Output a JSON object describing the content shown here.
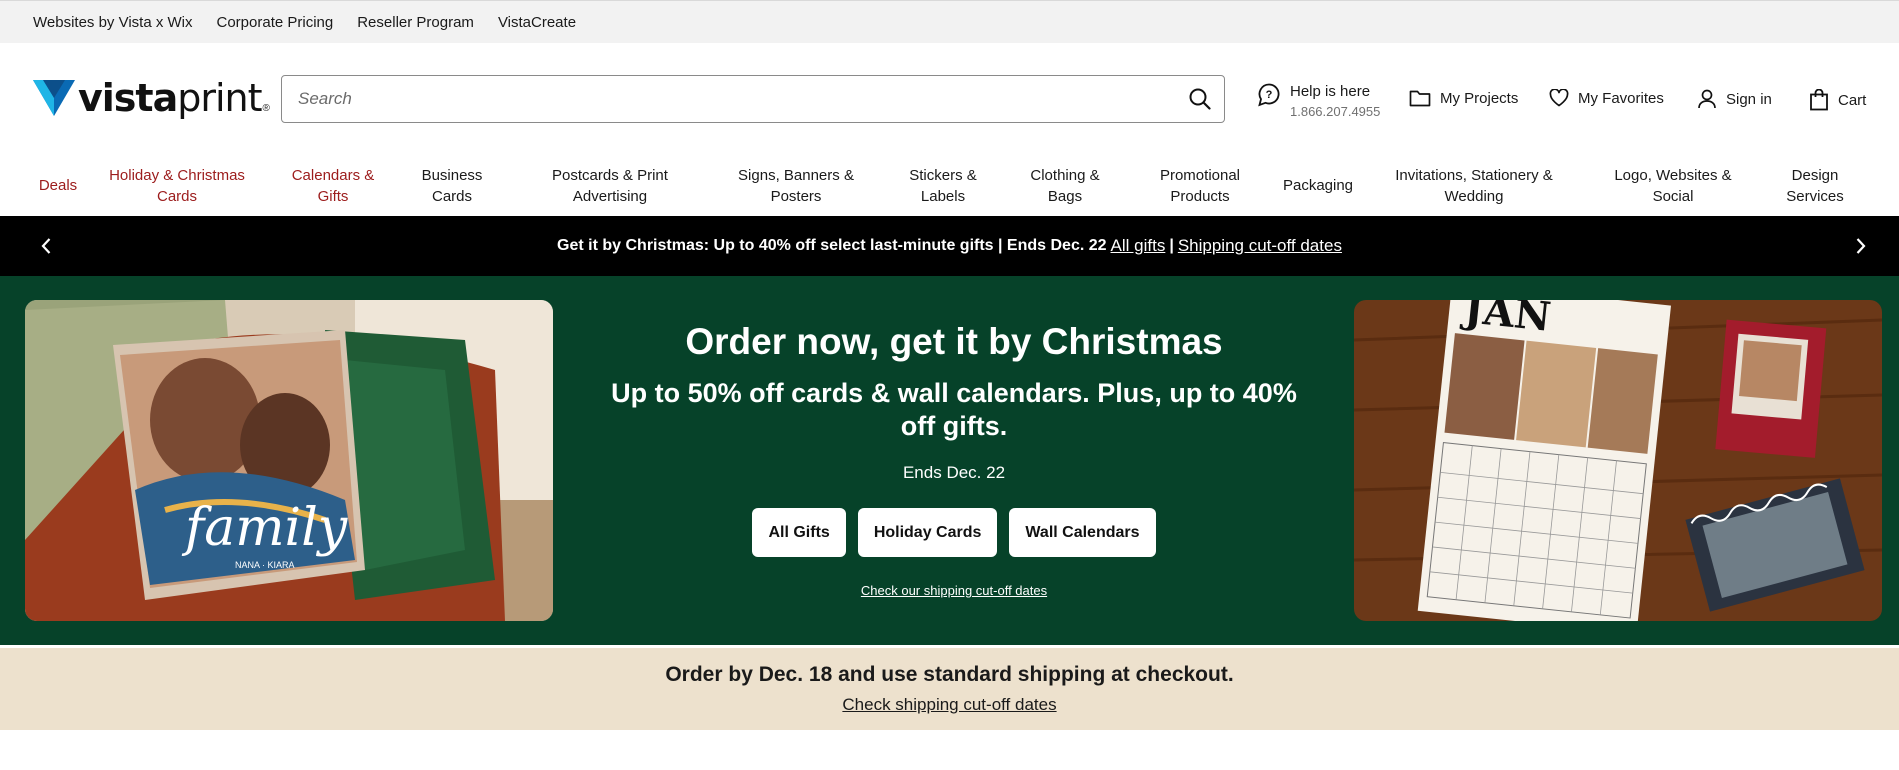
{
  "utility": {
    "links": [
      "Websites by Vista x Wix",
      "Corporate Pricing",
      "Reseller Program",
      "VistaCreate"
    ]
  },
  "brand": {
    "logo_primary": "vista",
    "logo_secondary": "print",
    "logo_mark": "®",
    "colors": {
      "logo_blue": "#0a6ab4",
      "logo_cyan": "#1fb5e6",
      "nav_red": "#9c1c1c",
      "hero_green": "#064229",
      "banner_beige": "#ede1cd"
    }
  },
  "search": {
    "placeholder": "Search",
    "icon": "search-icon"
  },
  "help": {
    "title": "Help is here",
    "phone": "1.866.207.4955",
    "icon": "help-bubble-icon"
  },
  "header_links": {
    "projects": "My Projects",
    "favorites": "My Favorites",
    "signin": "Sign in",
    "cart": "Cart"
  },
  "nav": {
    "items": [
      {
        "label": "Deals"
      },
      {
        "label": "Holiday & Christmas Cards"
      },
      {
        "label": "Calendars & Gifts"
      },
      {
        "label": "Business Cards"
      },
      {
        "label": "Postcards & Print Advertising"
      },
      {
        "label": "Signs, Banners & Posters"
      },
      {
        "label": "Stickers & Labels"
      },
      {
        "label": "Clothing & Bags"
      },
      {
        "label": "Promotional Products"
      },
      {
        "label": "Packaging"
      },
      {
        "label": "Invitations, Stationery & Wedding"
      },
      {
        "label": "Logo, Websites & Social"
      },
      {
        "label": "Design Services"
      }
    ]
  },
  "promo": {
    "text": "Get it by Christmas: Up to 40% off select last-minute gifts | Ends Dec. 22",
    "link1": "All gifts",
    "separator": "|",
    "link2": "Shipping cut-off dates"
  },
  "hero": {
    "title": "Order now, get it by Christmas",
    "subtitle": "Up to 50% off cards & wall calendars. Plus, up to 40% off gifts.",
    "ends": "Ends Dec. 22",
    "buttons": [
      "All Gifts",
      "Holiday Cards",
      "Wall Calendars"
    ],
    "link": "Check our shipping cut-off dates",
    "left_image": {
      "pillow_text": "family",
      "pillow_names": "NANA · KIARA"
    },
    "right_image": {
      "calendar_month": "JAN"
    }
  },
  "shipping_banner": {
    "title": "Order by Dec. 18 and use standard shipping at checkout.",
    "link": "Check shipping cut-off dates"
  }
}
